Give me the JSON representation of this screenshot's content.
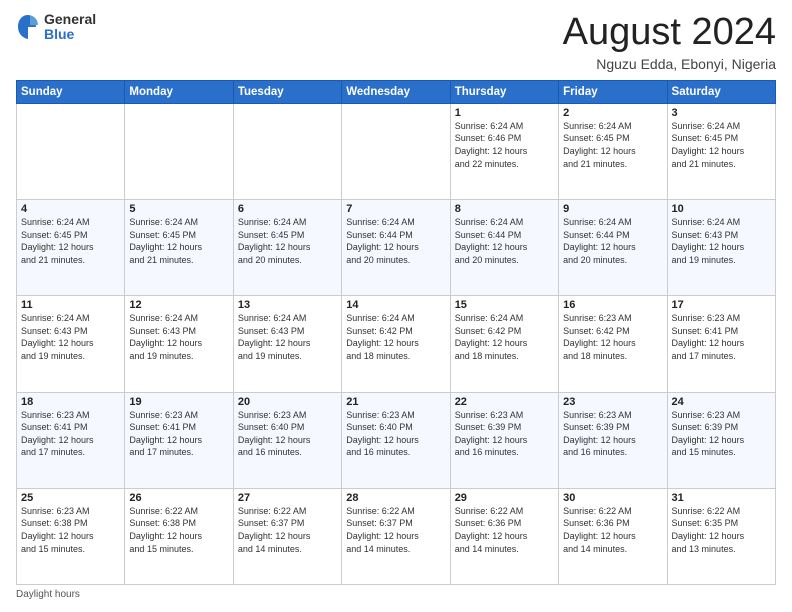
{
  "logo": {
    "general": "General",
    "blue": "Blue"
  },
  "header": {
    "month": "August 2024",
    "location": "Nguzu Edda, Ebonyi, Nigeria"
  },
  "weekdays": [
    "Sunday",
    "Monday",
    "Tuesday",
    "Wednesday",
    "Thursday",
    "Friday",
    "Saturday"
  ],
  "weeks": [
    [
      {
        "day": "",
        "info": ""
      },
      {
        "day": "",
        "info": ""
      },
      {
        "day": "",
        "info": ""
      },
      {
        "day": "",
        "info": ""
      },
      {
        "day": "1",
        "info": "Sunrise: 6:24 AM\nSunset: 6:46 PM\nDaylight: 12 hours\nand 22 minutes."
      },
      {
        "day": "2",
        "info": "Sunrise: 6:24 AM\nSunset: 6:45 PM\nDaylight: 12 hours\nand 21 minutes."
      },
      {
        "day": "3",
        "info": "Sunrise: 6:24 AM\nSunset: 6:45 PM\nDaylight: 12 hours\nand 21 minutes."
      }
    ],
    [
      {
        "day": "4",
        "info": "Sunrise: 6:24 AM\nSunset: 6:45 PM\nDaylight: 12 hours\nand 21 minutes."
      },
      {
        "day": "5",
        "info": "Sunrise: 6:24 AM\nSunset: 6:45 PM\nDaylight: 12 hours\nand 21 minutes."
      },
      {
        "day": "6",
        "info": "Sunrise: 6:24 AM\nSunset: 6:45 PM\nDaylight: 12 hours\nand 20 minutes."
      },
      {
        "day": "7",
        "info": "Sunrise: 6:24 AM\nSunset: 6:44 PM\nDaylight: 12 hours\nand 20 minutes."
      },
      {
        "day": "8",
        "info": "Sunrise: 6:24 AM\nSunset: 6:44 PM\nDaylight: 12 hours\nand 20 minutes."
      },
      {
        "day": "9",
        "info": "Sunrise: 6:24 AM\nSunset: 6:44 PM\nDaylight: 12 hours\nand 20 minutes."
      },
      {
        "day": "10",
        "info": "Sunrise: 6:24 AM\nSunset: 6:43 PM\nDaylight: 12 hours\nand 19 minutes."
      }
    ],
    [
      {
        "day": "11",
        "info": "Sunrise: 6:24 AM\nSunset: 6:43 PM\nDaylight: 12 hours\nand 19 minutes."
      },
      {
        "day": "12",
        "info": "Sunrise: 6:24 AM\nSunset: 6:43 PM\nDaylight: 12 hours\nand 19 minutes."
      },
      {
        "day": "13",
        "info": "Sunrise: 6:24 AM\nSunset: 6:43 PM\nDaylight: 12 hours\nand 19 minutes."
      },
      {
        "day": "14",
        "info": "Sunrise: 6:24 AM\nSunset: 6:42 PM\nDaylight: 12 hours\nand 18 minutes."
      },
      {
        "day": "15",
        "info": "Sunrise: 6:24 AM\nSunset: 6:42 PM\nDaylight: 12 hours\nand 18 minutes."
      },
      {
        "day": "16",
        "info": "Sunrise: 6:23 AM\nSunset: 6:42 PM\nDaylight: 12 hours\nand 18 minutes."
      },
      {
        "day": "17",
        "info": "Sunrise: 6:23 AM\nSunset: 6:41 PM\nDaylight: 12 hours\nand 17 minutes."
      }
    ],
    [
      {
        "day": "18",
        "info": "Sunrise: 6:23 AM\nSunset: 6:41 PM\nDaylight: 12 hours\nand 17 minutes."
      },
      {
        "day": "19",
        "info": "Sunrise: 6:23 AM\nSunset: 6:41 PM\nDaylight: 12 hours\nand 17 minutes."
      },
      {
        "day": "20",
        "info": "Sunrise: 6:23 AM\nSunset: 6:40 PM\nDaylight: 12 hours\nand 16 minutes."
      },
      {
        "day": "21",
        "info": "Sunrise: 6:23 AM\nSunset: 6:40 PM\nDaylight: 12 hours\nand 16 minutes."
      },
      {
        "day": "22",
        "info": "Sunrise: 6:23 AM\nSunset: 6:39 PM\nDaylight: 12 hours\nand 16 minutes."
      },
      {
        "day": "23",
        "info": "Sunrise: 6:23 AM\nSunset: 6:39 PM\nDaylight: 12 hours\nand 16 minutes."
      },
      {
        "day": "24",
        "info": "Sunrise: 6:23 AM\nSunset: 6:39 PM\nDaylight: 12 hours\nand 15 minutes."
      }
    ],
    [
      {
        "day": "25",
        "info": "Sunrise: 6:23 AM\nSunset: 6:38 PM\nDaylight: 12 hours\nand 15 minutes."
      },
      {
        "day": "26",
        "info": "Sunrise: 6:22 AM\nSunset: 6:38 PM\nDaylight: 12 hours\nand 15 minutes."
      },
      {
        "day": "27",
        "info": "Sunrise: 6:22 AM\nSunset: 6:37 PM\nDaylight: 12 hours\nand 14 minutes."
      },
      {
        "day": "28",
        "info": "Sunrise: 6:22 AM\nSunset: 6:37 PM\nDaylight: 12 hours\nand 14 minutes."
      },
      {
        "day": "29",
        "info": "Sunrise: 6:22 AM\nSunset: 6:36 PM\nDaylight: 12 hours\nand 14 minutes."
      },
      {
        "day": "30",
        "info": "Sunrise: 6:22 AM\nSunset: 6:36 PM\nDaylight: 12 hours\nand 14 minutes."
      },
      {
        "day": "31",
        "info": "Sunrise: 6:22 AM\nSunset: 6:35 PM\nDaylight: 12 hours\nand 13 minutes."
      }
    ]
  ],
  "footer": {
    "note": "Daylight hours"
  }
}
